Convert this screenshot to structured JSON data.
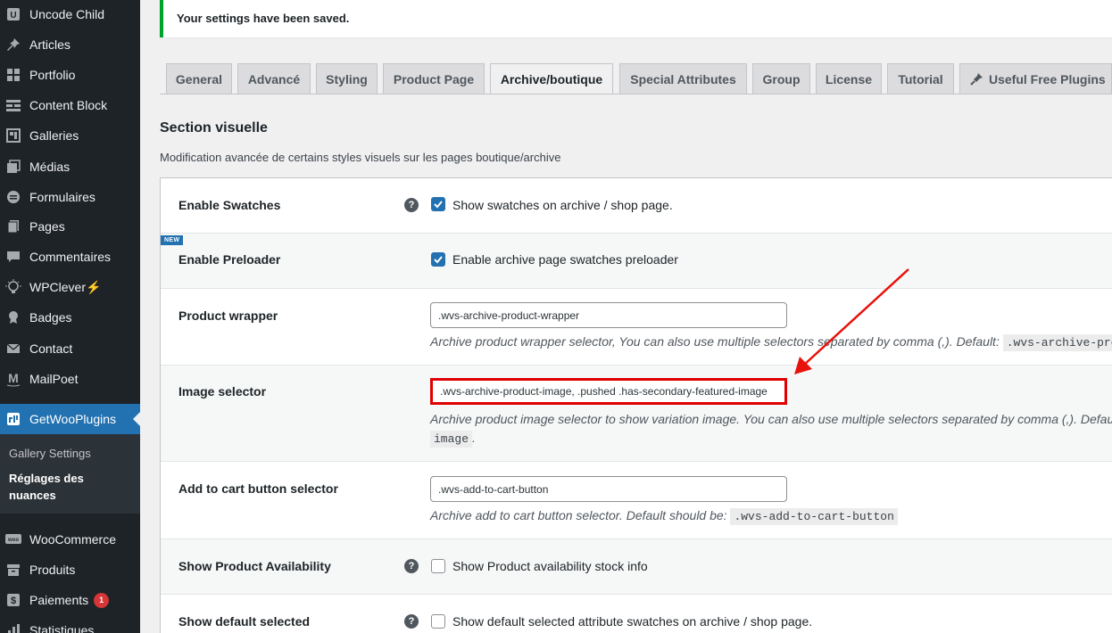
{
  "sidebar": {
    "items": [
      {
        "label": "Uncode Child",
        "icon": "U"
      },
      {
        "label": "Articles",
        "icon": "pin"
      },
      {
        "label": "Portfolio",
        "icon": "grid"
      },
      {
        "label": "Content Block",
        "icon": "block"
      },
      {
        "label": "Galleries",
        "icon": "gallery"
      },
      {
        "label": "Médias",
        "icon": "media"
      },
      {
        "label": "Formulaires",
        "icon": "form"
      },
      {
        "label": "Pages",
        "icon": "page"
      },
      {
        "label": "Commentaires",
        "icon": "comment"
      },
      {
        "label": "WPClever⚡",
        "icon": "bulb"
      },
      {
        "label": "Badges",
        "icon": "badge"
      },
      {
        "label": "Contact",
        "icon": "mail"
      },
      {
        "label": "MailPoet",
        "icon": "M"
      },
      {
        "label": "GetWooPlugins",
        "icon": "plugin"
      },
      {
        "label": "WooCommerce",
        "icon": "woo"
      },
      {
        "label": "Produits",
        "icon": "box"
      },
      {
        "label": "Paiements",
        "icon": "payment",
        "count": "1"
      },
      {
        "label": "Statistiques",
        "icon": "stats"
      }
    ],
    "submenu": [
      "Gallery Settings",
      "Réglages des",
      "nuances"
    ]
  },
  "notice": "Your settings have been saved.",
  "tabs": [
    "General",
    "Advancé",
    "Styling",
    "Product Page",
    "Archive/boutique",
    "Special Attributes",
    "Group",
    "License",
    "Tutorial",
    "Useful Free Plugins"
  ],
  "active_tab": "Archive/boutique",
  "section": {
    "title": "Section visuelle",
    "description": "Modification avancée de certains styles visuels sur les pages boutique/archive"
  },
  "rows": {
    "enable_swatches": {
      "label": "Enable Swatches",
      "checkbox_label": "Show swatches on archive / shop page.",
      "checked": true
    },
    "enable_preloader": {
      "label": "Enable Preloader",
      "badge": "NEW",
      "checkbox_label": "Enable archive page swatches preloader",
      "checked": true
    },
    "product_wrapper": {
      "label": "Product wrapper",
      "value": ".wvs-archive-product-wrapper",
      "desc": "Archive product wrapper selector, You can also use multiple selectors separated by comma (,). Default:",
      "default": ".wvs-archive-product-wrapper"
    },
    "image_selector": {
      "label": "Image selector",
      "value": ".wvs-archive-product-image, .pushed .has-secondary-featured-image",
      "desc": "Archive product image selector to show variation image. You can also use multiple selectors separated by comma (,). Default:",
      "default_cont": "image",
      "period": "."
    },
    "add_to_cart": {
      "label": "Add to cart button selector",
      "value": ".wvs-add-to-cart-button",
      "desc": "Archive add to cart button selector. Default should be:",
      "default": ".wvs-add-to-cart-button"
    },
    "show_availability": {
      "label": "Show Product Availability",
      "checkbox_label": "Show Product availability stock info",
      "checked": false
    },
    "show_default_selected": {
      "label": "Show default selected",
      "checkbox_label": "Show default selected attribute swatches on archive / shop page.",
      "checked": false
    }
  },
  "colors": {
    "accent": "#2271b1",
    "highlight": "#e00000",
    "sidebar_bg": "#1d2327",
    "success": "#00a32a"
  }
}
